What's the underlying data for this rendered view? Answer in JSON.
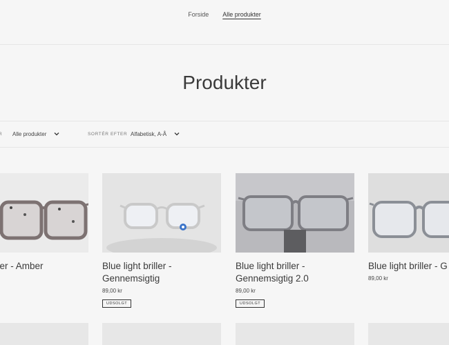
{
  "nav": {
    "items": [
      "Forside",
      "Alle produkter"
    ]
  },
  "page_title": "Produkter",
  "filters": {
    "filter_label": "R",
    "filter_value": "Alle produkter",
    "sort_label": "SORTÉR EFTER",
    "sort_value": "Alfabetisk, A-Å"
  },
  "products": [
    {
      "name": "ght briller - Amber",
      "price": "",
      "badge": ""
    },
    {
      "name": "Blue light briller - Gennemsigtig",
      "price": "89,00 kr",
      "badge": "UDSOLGT"
    },
    {
      "name": "Blue light briller - Gennemsigtig 2.0",
      "price": "89,00 kr",
      "badge": "UDSOLGT"
    },
    {
      "name": "Blue light briller - G",
      "price": "89,00 kr",
      "badge": ""
    }
  ],
  "colors": {
    "background": "#f6f6f6",
    "text": "#333333"
  }
}
